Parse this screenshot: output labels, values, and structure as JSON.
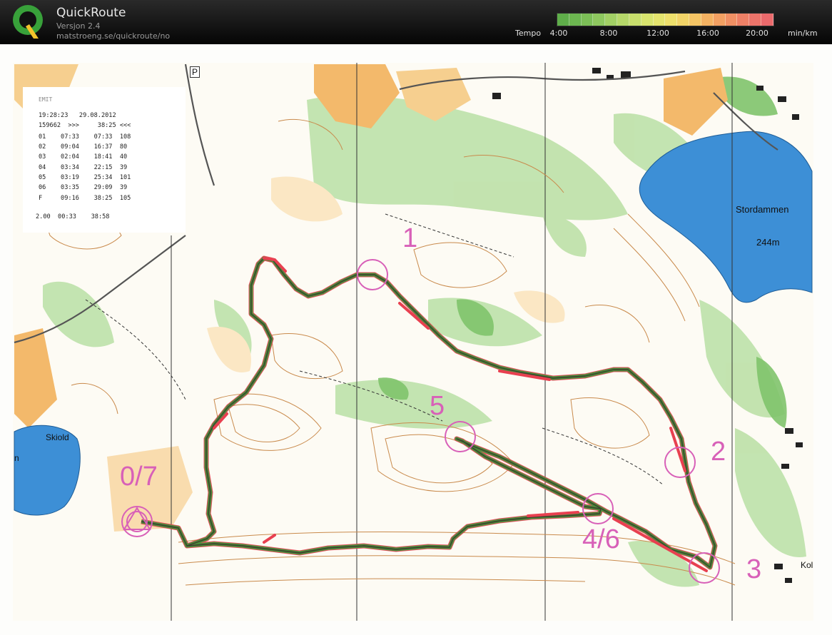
{
  "header": {
    "title": "QuickRoute",
    "version": "Versjon 2.4",
    "url": "matstroeng.se/quickroute/no"
  },
  "pace_legend": {
    "label": "Tempo",
    "ticks": [
      "4:00",
      "8:00",
      "12:00",
      "16:00",
      "20:00"
    ],
    "unit": "min/km",
    "colors": [
      "#5fae4a",
      "#6cb650",
      "#7cbf57",
      "#8ec85f",
      "#a2d065",
      "#b6d86a",
      "#c8de6c",
      "#d8e46e",
      "#e4e46e",
      "#eee06c",
      "#f2d468",
      "#f4c464",
      "#f4b262",
      "#f2a062",
      "#f09064",
      "#ee8066",
      "#ec746a",
      "#ea6a6c"
    ]
  },
  "splits": {
    "line_date": "19:28:23   29.08.2012",
    "line_summary": "159662  >>>     38:25 <<<",
    "rows": [
      "01    07:33    07:33  108",
      "02    09:04    16:37  80",
      "03    02:04    18:41  40",
      "04    03:34    22:15  39",
      "05    03:19    25:34  101",
      "06    03:35    29:09  39",
      "F     09:16    38:25  105"
    ],
    "footer": "2.00  00:33    38:58"
  },
  "map": {
    "labels": {
      "lake_east": "Stordammen",
      "lake_east_height": "244m",
      "lake_west": "Skiold",
      "west_edge": "n",
      "east_edge": "Kol",
      "parking": "P"
    },
    "controls": {
      "start_finish": "0/7",
      "c1": "1",
      "c2": "2",
      "c3": "3",
      "c4_6": "4/6",
      "c5": "5"
    },
    "route_colors": {
      "fast": "#4a8a3a",
      "slow": "#e84050",
      "core": "#3d3d2d"
    }
  }
}
